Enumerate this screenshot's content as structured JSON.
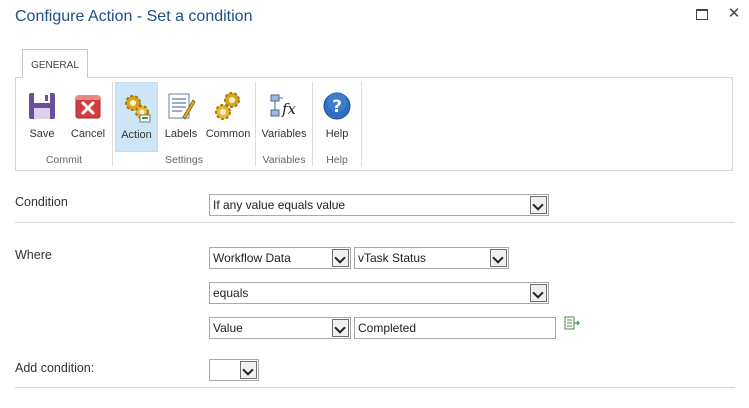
{
  "window": {
    "title": "Configure Action - Set a condition"
  },
  "ribbon": {
    "tab": "GENERAL",
    "groups": [
      {
        "name": "Commit",
        "buttons": [
          {
            "label": "Save",
            "icon": "save-icon"
          },
          {
            "label": "Cancel",
            "icon": "cancel-icon"
          }
        ]
      },
      {
        "name": "Settings",
        "buttons": [
          {
            "label": "Action",
            "icon": "action-gears-icon",
            "active": true
          },
          {
            "label": "Labels",
            "icon": "labels-icon"
          },
          {
            "label": "Common",
            "icon": "common-gears-icon"
          }
        ]
      },
      {
        "name": "Variables",
        "buttons": [
          {
            "label": "Variables",
            "icon": "variables-fx-icon"
          }
        ]
      },
      {
        "name": "Help",
        "buttons": [
          {
            "label": "Help",
            "icon": "help-icon"
          }
        ]
      }
    ]
  },
  "form": {
    "condition": {
      "label": "Condition",
      "value": "If any value equals value"
    },
    "where": {
      "label": "Where",
      "source": "Workflow Data",
      "variable": "vTask Status",
      "operator": "equals",
      "value_type": "Value",
      "value": "Completed"
    },
    "add_condition": {
      "label": "Add condition:",
      "value": ""
    }
  },
  "colors": {
    "title": "#1e4e8c",
    "active_button": "#cde6f7"
  }
}
